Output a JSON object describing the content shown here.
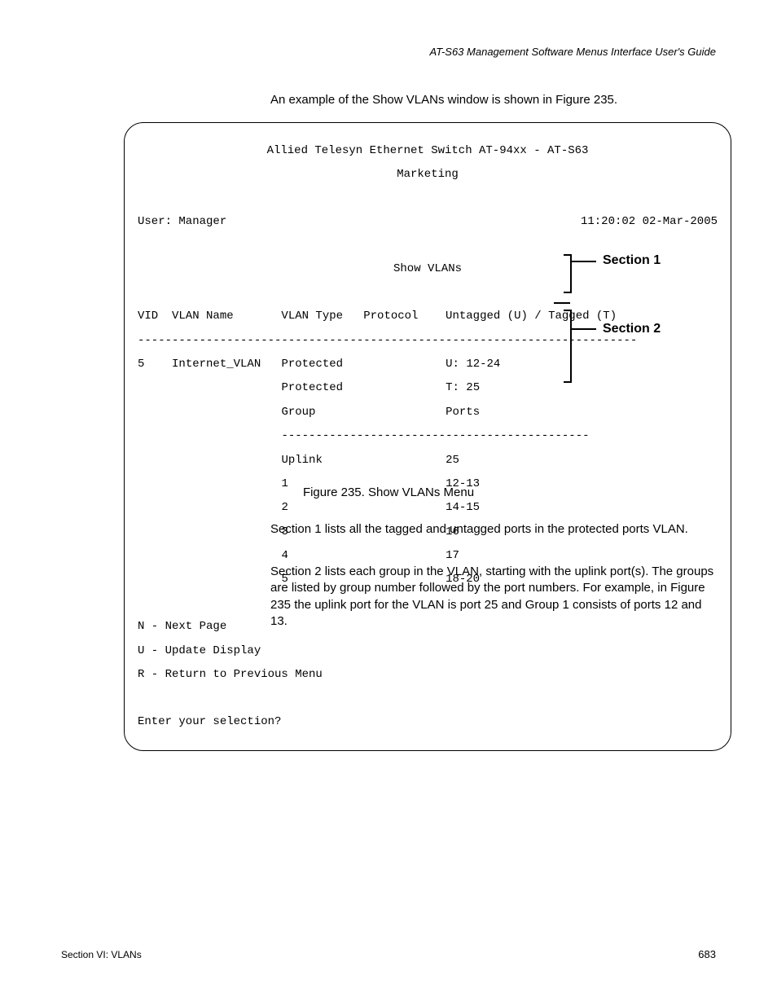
{
  "header": "AT-S63 Management Software Menus Interface User's Guide",
  "intro": "An example of the Show VLANs window is shown in Figure 235.",
  "terminal": {
    "title1": "Allied Telesyn Ethernet Switch AT-94xx - AT-S63",
    "title2": "Marketing",
    "user_label": "User: Manager",
    "timestamp": "11:20:02 02-Mar-2005",
    "view_title": "Show VLANs",
    "col_headers": "VID  VLAN Name       VLAN Type   Protocol    Untagged (U) / Tagged (T)",
    "rule": "-------------------------------------------------------------------------",
    "row": {
      "vid": "5",
      "name": "Internet_VLAN",
      "type_l1": "Protected",
      "type_l2": "Protected",
      "type_l3": "Group",
      "ports_l1": "U: 12-24",
      "ports_l2": "T: 25",
      "ports_l3": "Ports"
    },
    "subrule": "---------------------------------------------",
    "groups_col": [
      "Uplink",
      "1",
      "2",
      "3",
      "4",
      "5"
    ],
    "ports_col": [
      "25",
      "12-13",
      "14-15",
      "16",
      "17",
      "18-20"
    ],
    "legend_n": "N - Next Page",
    "legend_u": "U - Update Display",
    "legend_r": "R - Return to Previous Menu",
    "prompt": "Enter your selection?"
  },
  "annotation1": "Section 1",
  "annotation2": "Section 2",
  "caption": "Figure 235. Show VLANs Menu",
  "para1": "Section 1 lists all the tagged and untagged ports in the protected ports VLAN.",
  "para2": "Section 2 lists each group in the VLAN, starting with the uplink port(s). The groups are listed by group number followed by the port numbers. For example, in Figure 235 the uplink port for the VLAN is port 25 and Group 1 consists of ports 12 and 13.",
  "footer_left": "Section VI: VLANs",
  "footer_right": "683"
}
